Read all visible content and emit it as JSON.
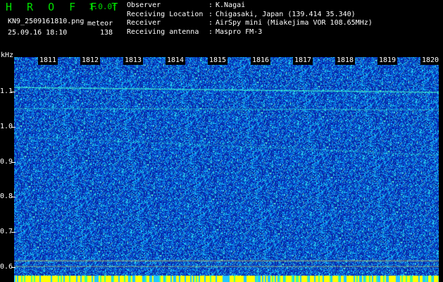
{
  "app": {
    "title": "H R O F F T",
    "version": "1.0.0f"
  },
  "file": {
    "name": "KN9_2509161810.png",
    "datetime": "25.09.16 18:10",
    "meteor_label": "meteor",
    "meteor_count": "138"
  },
  "info": [
    {
      "key": "Observer",
      "value": "K.Nagai"
    },
    {
      "key": "Receiving Location",
      "value": "Chigasaki, Japan (139.414 35.340)"
    },
    {
      "key": "Receiver",
      "value": "AirSpy mini (Miakejima VOR 108.65MHz)"
    },
    {
      "key": "Receiving antenna",
      "value": "Maspro FM-3"
    }
  ],
  "axis": {
    "unit": "kHz",
    "time_labels": [
      "1811",
      "1812",
      "1813",
      "1814",
      "1815",
      "1816",
      "1817",
      "1818",
      "1819",
      "1820"
    ],
    "freq_labels": [
      "1.1",
      "1.0",
      "0.9",
      "0.8",
      "0.7",
      "0.6"
    ]
  },
  "colors": {
    "title": "#00e000",
    "background": "#000000",
    "plot_base": "#0a1fb0",
    "noise": "#1ac8ff",
    "carrier": "#40ffd0",
    "bottom_strip": "#ffff00"
  }
}
